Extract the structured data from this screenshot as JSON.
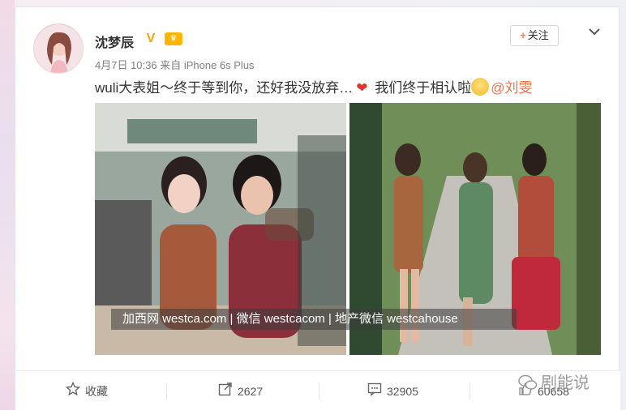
{
  "post": {
    "username": "沈梦辰",
    "verified_badge": "V",
    "vip_badge": "♛",
    "follow_label": "关注",
    "follow_plus": "+",
    "meta": "4月7日 10:36 来自 iPhone 6s Plus",
    "text_before": "wuli大表姐～终于等到你，还好我没放弃…",
    "text_after": " 我们终于相认啦",
    "mention": "@刘雯",
    "watermark": "加西网 westca.com | 微信 westcacom | 地产微信 westcahouse"
  },
  "actions": {
    "favorite_label": "收藏",
    "share_count": "2627",
    "comment_count": "32905",
    "like_count": "60658"
  },
  "brand_watermark": "剧能说",
  "colors": {
    "accent_orange": "#eb7350",
    "verified": "#f7a300"
  }
}
